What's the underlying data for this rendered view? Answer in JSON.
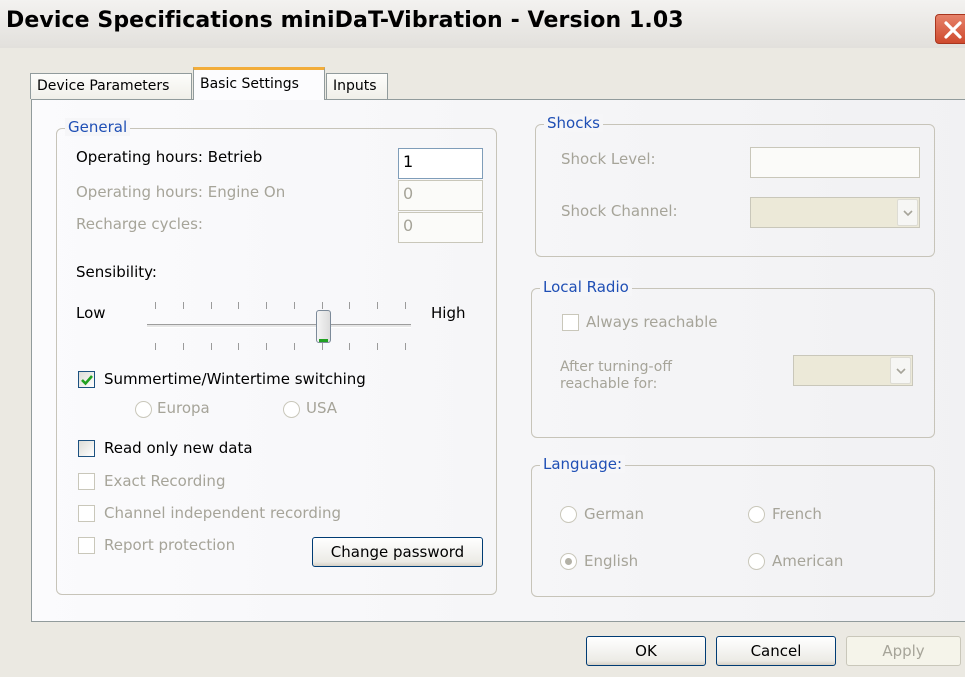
{
  "window": {
    "title": "Device Specifications miniDaT-Vibration - Version 1.03"
  },
  "tabs": [
    "Device Parameters",
    "Basic Settings",
    "Inputs"
  ],
  "general": {
    "legend": "General",
    "operating_hours_betrieb_label": "Operating hours: Betrieb",
    "operating_hours_betrieb_value": "1",
    "operating_hours_engine_label": "Operating hours: Engine On",
    "operating_hours_engine_value": "0",
    "recharge_cycles_label": "Recharge cycles:",
    "recharge_cycles_value": "0",
    "sensibility_label": "Sensibility:",
    "sensibility_low": "Low",
    "sensibility_high": "High",
    "sensibility_level": 0.67,
    "summertime_label": "Summertime/Wintertime switching",
    "summertime_checked": true,
    "region_europa": "Europa",
    "region_usa": "USA",
    "read_new_label": "Read only new data",
    "exact_recording_label": "Exact Recording",
    "channel_independent_label": "Channel independent recording",
    "report_protection_label": "Report protection",
    "change_password_label": "Change password"
  },
  "shocks": {
    "legend": "Shocks",
    "level_label": "Shock Level:",
    "level_value": "",
    "channel_label": "Shock Channel:",
    "channel_value": ""
  },
  "local_radio": {
    "legend": "Local Radio",
    "always_reachable_label": "Always reachable",
    "after_off_label_line1": "After turning-off",
    "after_off_label_line2": "reachable for:",
    "after_off_value": ""
  },
  "language": {
    "legend": "Language:",
    "german": "German",
    "french": "French",
    "english": "English",
    "american": "American",
    "selected": "English"
  },
  "buttons": {
    "ok": "OK",
    "cancel": "Cancel",
    "apply": "Apply"
  },
  "colors": {
    "legend_text": "#1f4fb5",
    "disabled_text": "#a6a499",
    "dialog_face": "#ebe9e2",
    "tab_highlight": "#f2ad3a",
    "close_button": "#d9583a"
  }
}
